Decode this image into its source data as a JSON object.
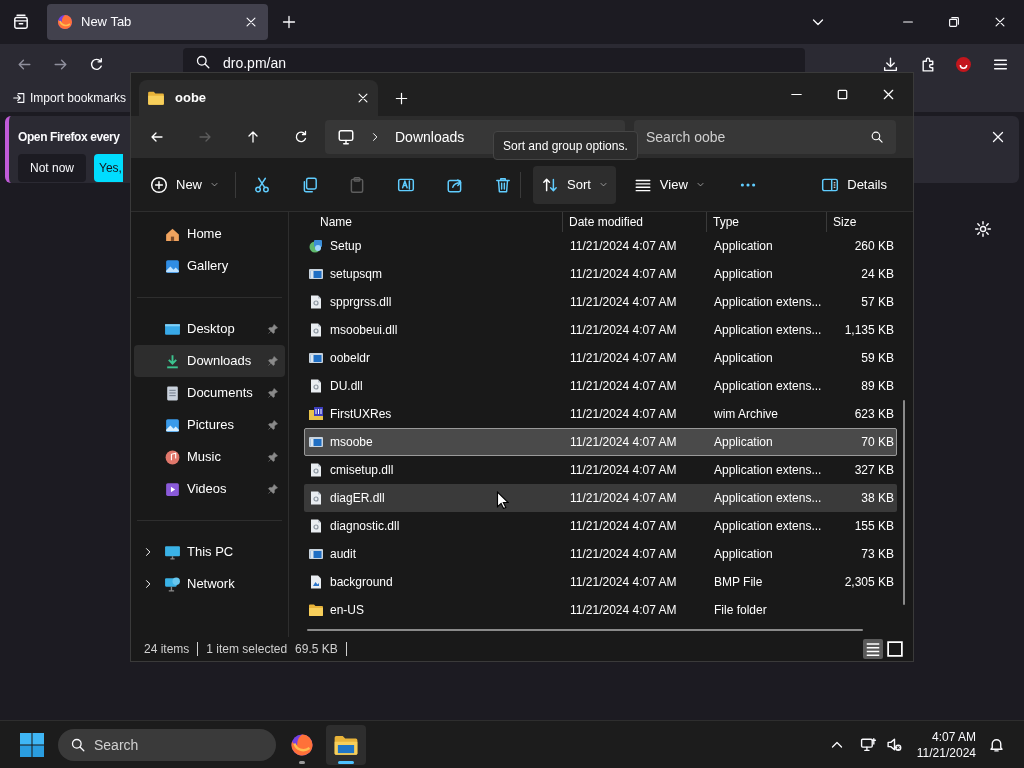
{
  "browser": {
    "tabs": [
      {
        "label": "New Tab",
        "selected": true
      }
    ],
    "url": "dro.pm/an",
    "bookmarks": [
      {
        "label": "Import bookmarks"
      }
    ],
    "notification": {
      "message": "Open Firefox every",
      "buttons": [
        {
          "label": "Not now",
          "kind": "secondary"
        },
        {
          "label": "Yes,",
          "kind": "primary"
        }
      ]
    }
  },
  "explorer": {
    "tabs": [
      {
        "label": "oobe",
        "selected": true
      }
    ],
    "nav": [
      {
        "kind": "back",
        "disabled": false
      },
      {
        "kind": "forward",
        "disabled": true
      },
      {
        "kind": "up",
        "disabled": false
      },
      {
        "kind": "refresh",
        "disabled": false
      }
    ],
    "breadcrumb": [
      "Downloads"
    ],
    "search": {
      "placeholder": "Search oobe"
    },
    "toolbar": [
      {
        "kind": "new",
        "label": "New",
        "disabled": false,
        "hovered": false
      },
      {
        "kind": "cut",
        "disabled": false,
        "hovered": false
      },
      {
        "kind": "copy",
        "disabled": false,
        "hovered": false
      },
      {
        "kind": "paste",
        "disabled": true,
        "hovered": false
      },
      {
        "kind": "rename",
        "disabled": false,
        "hovered": false
      },
      {
        "kind": "share",
        "disabled": false,
        "hovered": false
      },
      {
        "kind": "delete",
        "disabled": false,
        "hovered": false
      },
      {
        "kind": "sort",
        "label": "Sort",
        "disabled": false,
        "hovered": true
      },
      {
        "kind": "view",
        "label": "View",
        "disabled": false,
        "hovered": false
      },
      {
        "kind": "more",
        "disabled": false,
        "hovered": false
      },
      {
        "kind": "details",
        "label": "Details",
        "disabled": false,
        "hovered": false
      }
    ],
    "tooltip": "Sort and group options.",
    "sidebar": {
      "sections": [
        {
          "items": [
            {
              "label": "Home",
              "kind": "home",
              "selected": false
            },
            {
              "label": "Gallery",
              "kind": "gallery",
              "selected": false
            }
          ]
        },
        {
          "items": [
            {
              "label": "Desktop",
              "kind": "desktop",
              "selected": false,
              "pinned": true
            },
            {
              "label": "Downloads",
              "kind": "downloads",
              "selected": true,
              "pinned": true
            },
            {
              "label": "Documents",
              "kind": "documents",
              "selected": false,
              "pinned": true
            },
            {
              "label": "Pictures",
              "kind": "pictures",
              "selected": false,
              "pinned": true
            },
            {
              "label": "Music",
              "kind": "music",
              "selected": false,
              "pinned": true
            },
            {
              "label": "Videos",
              "kind": "videos",
              "selected": false,
              "pinned": true
            }
          ]
        },
        {
          "items": [
            {
              "label": "This PC",
              "kind": "pc",
              "selected": false,
              "expanded": false
            },
            {
              "label": "Network",
              "kind": "network",
              "selected": false,
              "expanded": false
            }
          ]
        }
      ]
    },
    "columns": [
      "Name",
      "Date modified",
      "Type",
      "Size"
    ],
    "rows": [
      {
        "name": "Setup",
        "kind": "setup",
        "date": "11/21/2024 4:07 AM",
        "type": "Application",
        "size": "260 KB",
        "selected": false,
        "hovered": false
      },
      {
        "name": "setupsqm",
        "kind": "app",
        "date": "11/21/2024 4:07 AM",
        "type": "Application",
        "size": "24 KB",
        "selected": false,
        "hovered": false
      },
      {
        "name": "spprgrss.dll",
        "kind": "dll",
        "date": "11/21/2024 4:07 AM",
        "type": "Application extens...",
        "size": "57 KB",
        "selected": false,
        "hovered": false
      },
      {
        "name": "msoobeui.dll",
        "kind": "dll",
        "date": "11/21/2024 4:07 AM",
        "type": "Application extens...",
        "size": "1,135 KB",
        "selected": false,
        "hovered": false
      },
      {
        "name": "oobeldr",
        "kind": "app",
        "date": "11/21/2024 4:07 AM",
        "type": "Application",
        "size": "59 KB",
        "selected": false,
        "hovered": false
      },
      {
        "name": "DU.dll",
        "kind": "dll",
        "date": "11/21/2024 4:07 AM",
        "type": "Application extens...",
        "size": "89 KB",
        "selected": false,
        "hovered": false
      },
      {
        "name": "FirstUXRes",
        "kind": "archive",
        "date": "11/21/2024 4:07 AM",
        "type": "wim Archive",
        "size": "623 KB",
        "selected": false,
        "hovered": false
      },
      {
        "name": "msoobe",
        "kind": "app",
        "date": "11/21/2024 4:07 AM",
        "type": "Application",
        "size": "70 KB",
        "selected": true,
        "hovered": false
      },
      {
        "name": "cmisetup.dll",
        "kind": "dll",
        "date": "11/21/2024 4:07 AM",
        "type": "Application extens...",
        "size": "327 KB",
        "selected": false,
        "hovered": false
      },
      {
        "name": "diagER.dll",
        "kind": "dll",
        "date": "11/21/2024 4:07 AM",
        "type": "Application extens...",
        "size": "38 KB",
        "selected": false,
        "hovered": true
      },
      {
        "name": "diagnostic.dll",
        "kind": "dll",
        "date": "11/21/2024 4:07 AM",
        "type": "Application extens...",
        "size": "155 KB",
        "selected": false,
        "hovered": false
      },
      {
        "name": "audit",
        "kind": "app",
        "date": "11/21/2024 4:07 AM",
        "type": "Application",
        "size": "73 KB",
        "selected": false,
        "hovered": false
      },
      {
        "name": "background",
        "kind": "bmp",
        "date": "11/21/2024 4:07 AM",
        "type": "BMP File",
        "size": "2,305 KB",
        "selected": false,
        "hovered": false
      },
      {
        "name": "en-US",
        "kind": "folder",
        "date": "11/21/2024 4:07 AM",
        "type": "File folder",
        "selected": false,
        "hovered": false
      }
    ],
    "status": [
      "24 items",
      "1 item selected",
      "69.5 KB"
    ],
    "view_modes": [
      {
        "kind": "details",
        "selected": true
      },
      {
        "kind": "tiles",
        "selected": false
      }
    ]
  },
  "taskbar": {
    "search": {
      "placeholder": "Search"
    },
    "apps": [
      {
        "kind": "browser",
        "active": false
      },
      {
        "kind": "explorer",
        "active": true
      }
    ],
    "time": "4:07 AM",
    "date": "11/21/2024"
  }
}
